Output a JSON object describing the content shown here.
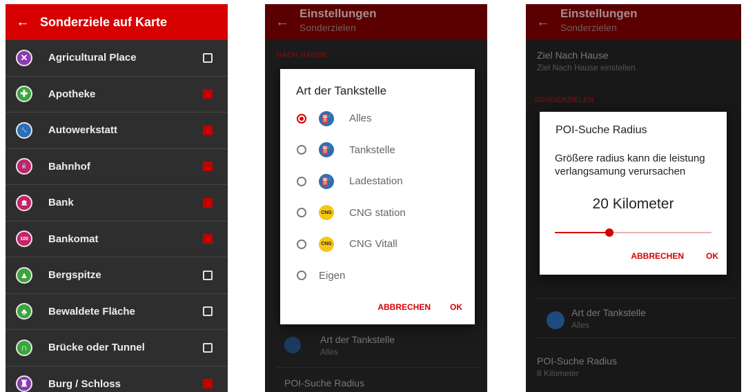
{
  "screen1": {
    "title": "Sonderziele auf Karte",
    "items": [
      {
        "label": "Agricultural Place",
        "checked": false,
        "icon": "windmill-icon",
        "color": "#8a3bb0",
        "glyph": "✕"
      },
      {
        "label": "Apotheke",
        "checked": true,
        "icon": "pharmacy-cross-icon",
        "color": "#3aa53a",
        "glyph": "✚"
      },
      {
        "label": "Autowerkstatt",
        "checked": true,
        "icon": "wrench-icon",
        "color": "#2a6fb6",
        "glyph": "🔧"
      },
      {
        "label": "Bahnhof",
        "checked": true,
        "icon": "train-icon",
        "color": "#c8206a",
        "glyph": "🚆"
      },
      {
        "label": "Bank",
        "checked": true,
        "icon": "bank-icon",
        "color": "#c8206a",
        "glyph": "🏛"
      },
      {
        "label": "Bankomat",
        "checked": true,
        "icon": "atm-icon",
        "color": "#c8206a",
        "glyph": "100"
      },
      {
        "label": "Bergspitze",
        "checked": false,
        "icon": "mountain-peak-icon",
        "color": "#3aa53a",
        "glyph": "▲"
      },
      {
        "label": "Bewaldete Fläche",
        "checked": false,
        "icon": "forest-icon",
        "color": "#3aa53a",
        "glyph": "♣"
      },
      {
        "label": "Brücke oder Tunnel",
        "checked": false,
        "icon": "tunnel-icon",
        "color": "#3aa53a",
        "glyph": "∩"
      },
      {
        "label": "Burg / Schloss",
        "checked": true,
        "icon": "castle-icon",
        "color": "#8a3bb0",
        "glyph": "♜"
      }
    ]
  },
  "screen2": {
    "title": "Einstellungen",
    "subtitle": "Sonderzielen",
    "section_home": "NACH HAUSE",
    "dialog": {
      "title": "Art der Tankstelle",
      "options": [
        {
          "label": "Alles",
          "selected": true,
          "icon": "fuel-icon",
          "kind": "fuel",
          "badge": "⛽"
        },
        {
          "label": "Tankstelle",
          "selected": false,
          "icon": "fuel-icon",
          "kind": "fuel",
          "badge": "⛽"
        },
        {
          "label": "Ladestation",
          "selected": false,
          "icon": "fuel-icon",
          "kind": "fuel",
          "badge": "⛽"
        },
        {
          "label": "CNG station",
          "selected": false,
          "icon": "cng-icon",
          "kind": "cng",
          "badge": "CNG"
        },
        {
          "label": "CNG Vitall",
          "selected": false,
          "icon": "cng-icon",
          "kind": "cng",
          "badge": "CNG"
        },
        {
          "label": "Eigen",
          "selected": false,
          "icon": "",
          "kind": "none",
          "badge": ""
        }
      ],
      "cancel": "ABBRECHEN",
      "ok": "OK"
    },
    "row_tank_title": "Art der Tankstelle",
    "row_tank_value": "Alles",
    "row_radius_title": "POI-Suche Radius"
  },
  "screen3": {
    "title": "Einstellungen",
    "subtitle": "Sonderzielen",
    "home_title": "Ziel Nach Hause",
    "home_sub": "Ziel Nach Hause einstellen",
    "section_poi": "SONDERZIELEN",
    "dialog": {
      "title": "POI-Suche Radius",
      "message": "Größere radius kann die leistung verlangsamung verursachen",
      "value": "20 Kilometer",
      "slider_fraction": 0.35,
      "cancel": "ABBRECHEN",
      "ok": "OK"
    },
    "row_tank_title": "Art der Tankstelle",
    "row_tank_value": "Alles",
    "row_radius_title": "POI-Suche Radius",
    "row_radius_value": "8 Kilometer"
  },
  "colors": {
    "accent": "#d60000",
    "checked": "#c40000"
  }
}
